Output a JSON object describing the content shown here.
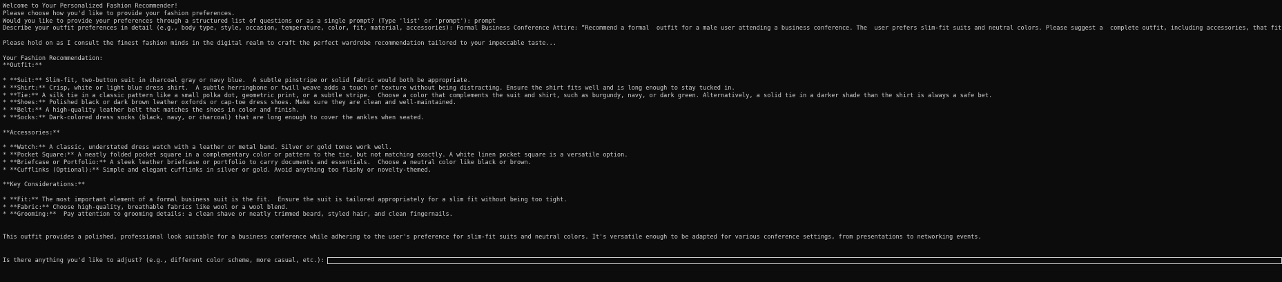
{
  "header": {
    "welcome": "Welcome to Your Personalized Fashion Recommender!",
    "choose": "Please choose how you'd like to provide your fashion preferences.",
    "method_prompt": "Would you like to provide your preferences through a structured list of questions or as a single prompt? (Type 'list' or 'prompt'): prompt",
    "describe_prompt": "Describe your outfit preferences in detail (e.g., body type, style, occasion, temperature, color, fit, material, accessories): Formal Business Conference Attire: “Recommend a formal  outfit for a male user attending a business conference. The  user prefers slim-fit suits and neutral colors. Please suggest a  complete outfit, including accessories, that fits a professional  setting.”",
    "hold_on": "Please hold on as I consult the finest fashion minds in the digital realm to craft the perfect wardrobe recommendation tailored to your impeccable taste..."
  },
  "recommendation": {
    "heading": "Your Fashion Recommendation:",
    "outfit_heading": "**Outfit:**",
    "outfit_items": [
      "* **Suit:** Slim-fit, two-button suit in charcoal gray or navy blue.  A subtle pinstripe or solid fabric would both be appropriate.",
      "* **Shirt:** Crisp, white or light blue dress shirt.  A subtle herringbone or twill weave adds a touch of texture without being distracting. Ensure the shirt fits well and is long enough to stay tucked in.",
      "* **Tie:** A silk tie in a classic pattern like a small polka dot, geometric print, or a subtle stripe.  Choose a color that complements the suit and shirt, such as burgundy, navy, or dark green. Alternatively, a solid tie in a darker shade than the shirt is always a safe bet.",
      "* **Shoes:** Polished black or dark brown leather oxfords or cap-toe dress shoes. Make sure they are clean and well-maintained.",
      "* **Belt:** A high-quality leather belt that matches the shoes in color and finish.",
      "* **Socks:** Dark-colored dress socks (black, navy, or charcoal) that are long enough to cover the ankles when seated."
    ],
    "accessories_heading": "**Accessories:**",
    "accessories_items": [
      "* **Watch:** A classic, understated dress watch with a leather or metal band. Silver or gold tones work well.",
      "* **Pocket Square:** A neatly folded pocket square in a complementary color or pattern to the tie, but not matching exactly. A white linen pocket square is a versatile option.",
      "* **Briefcase or Portfolio:** A sleek leather briefcase or portfolio to carry documents and essentials.  Choose a neutral color like black or brown.",
      "* **Cufflinks (Optional):** Simple and elegant cufflinks in silver or gold. Avoid anything too flashy or novelty-themed."
    ],
    "considerations_heading": "**Key Considerations:**",
    "considerations_items": [
      "* **Fit:** The most important element of a formal business suit is the fit.  Ensure the suit is tailored appropriately for a slim fit without being too tight.",
      "* **Fabric:** Choose high-quality, breathable fabrics like wool or a wool blend.",
      "* **Grooming:**  Pay attention to grooming details: a clean shave or neatly trimmed beard, styled hair, and clean fingernails."
    ],
    "summary": "This outfit provides a polished, professional look suitable for a business conference while adhering to the user's preference for slim-fit suits and neutral colors. It's versatile enough to be adapted for various conference settings, from presentations to networking events."
  },
  "adjust": {
    "prompt": "Is there anything you'd like to adjust? (e.g., different color scheme, more casual, etc.):",
    "value": ""
  },
  "colors": {
    "background": "#0c0c0c",
    "text": "#cccccc"
  }
}
